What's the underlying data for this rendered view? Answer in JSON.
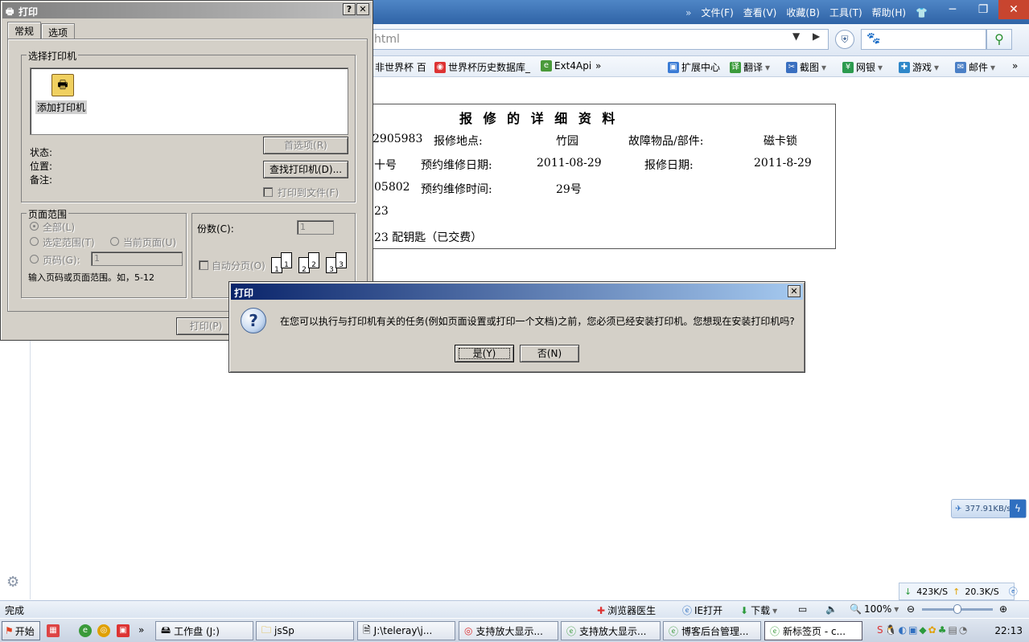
{
  "browser": {
    "menu": [
      "文件(F)",
      "查看(V)",
      "收藏(B)",
      "工具(T)",
      "帮助(H)"
    ],
    "menu_more": "»",
    "address_text": "html",
    "search_value": "🐾",
    "favorites": [
      {
        "label": "非世界杯 百"
      },
      {
        "label": "世界杯历史数据库_"
      },
      {
        "label": "Ext4Api"
      },
      {
        "label": "»"
      }
    ],
    "toolbar_right": [
      {
        "label": "扩展中心"
      },
      {
        "label": "翻译"
      },
      {
        "label": "截图"
      },
      {
        "label": "网银"
      },
      {
        "label": "游戏"
      },
      {
        "label": "邮件"
      }
    ],
    "toolbar_more": "»",
    "minimize": "─",
    "restore": "❐",
    "close": "✕"
  },
  "report": {
    "title": "报 修 的 详 细 资 料",
    "rows": [
      {
        "c1": "2905983",
        "c2": "报修地点:",
        "c3": "竹园",
        "c4": "故障物品/部件:",
        "c5": "磁卡锁"
      },
      {
        "c1": "十号",
        "c2": "预约维修日期:",
        "c3": "2011-08-29",
        "c4": "报修日期:",
        "c5": "2011-8-29"
      },
      {
        "c1": "05802",
        "c2": "预约维修时间:",
        "c3": "29号"
      },
      {
        "c1": "23"
      },
      {
        "c1": "23 配钥匙（已交费）"
      }
    ]
  },
  "print_dialog": {
    "title": "打印",
    "help": "?",
    "close": "✕",
    "tabs": [
      "常规",
      "选项"
    ],
    "select_printer_legend": "选择打印机",
    "add_printer": "添加打印机",
    "status_label": "状态:",
    "location_label": "位置:",
    "comment_label": "备注:",
    "preferences_btn": "首选项(R)",
    "find_printer_btn": "查找打印机(D)...",
    "print_to_file": "打印到文件(F)",
    "page_range_legend": "页面范围",
    "range_all": "全部(L)",
    "range_selection": "选定范围(T)",
    "range_current": "当前页面(U)",
    "range_pages": "页码(G):",
    "pages_value": "1",
    "range_hint": "输入页码或页面范围。如，5-12",
    "copies_label": "份数(C):",
    "copies_value": "1",
    "collate_label": "自动分页(O)",
    "print_btn": "打印(P)"
  },
  "confirm_dialog": {
    "title": "打印",
    "close": "✕",
    "message": "在您可以执行与打印机有关的任务(例如页面设置或打印一个文档)之前，您必须已经安装打印机。您想现在安装打印机吗?",
    "yes": "是(Y)",
    "no": "否(N)"
  },
  "widgets": {
    "speed": "377.91KB/s",
    "down_speed": "423K/S",
    "up_speed": "20.3K/S"
  },
  "status_bar": {
    "text": "完成",
    "doctor": "浏览器医生",
    "ie_open": "IE打开",
    "download": "下载",
    "zoom": "100%"
  },
  "taskbar": {
    "start": "开始",
    "more": "»",
    "tasks": [
      {
        "label": "工作盘 (J:)"
      },
      {
        "label": "jsSp"
      },
      {
        "label": "J:\\teleray\\j..."
      },
      {
        "label": "支持放大显示..."
      },
      {
        "label": "支持放大显示..."
      },
      {
        "label": "博客后台管理..."
      },
      {
        "label": "新标签页 - c..."
      }
    ],
    "clock": "22:13"
  }
}
